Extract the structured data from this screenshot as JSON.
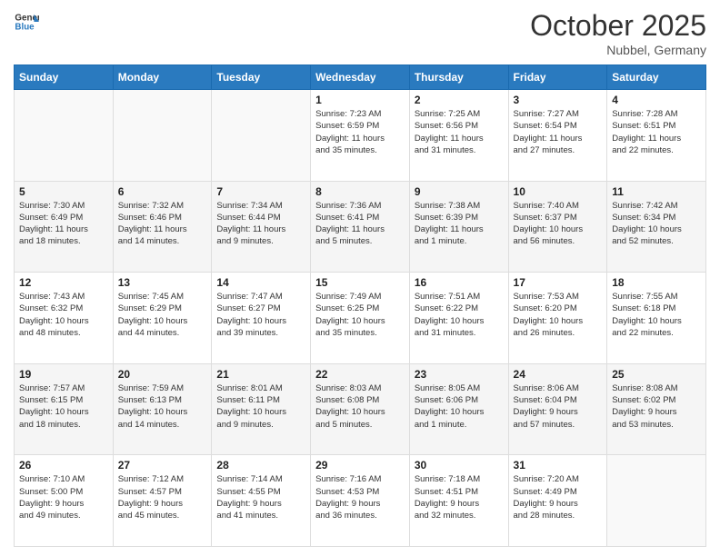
{
  "header": {
    "logo_general": "General",
    "logo_blue": "Blue",
    "month_title": "October 2025",
    "subtitle": "Nubbel, Germany"
  },
  "days_of_week": [
    "Sunday",
    "Monday",
    "Tuesday",
    "Wednesday",
    "Thursday",
    "Friday",
    "Saturday"
  ],
  "weeks": [
    [
      {
        "day": "",
        "info": ""
      },
      {
        "day": "",
        "info": ""
      },
      {
        "day": "",
        "info": ""
      },
      {
        "day": "1",
        "info": "Sunrise: 7:23 AM\nSunset: 6:59 PM\nDaylight: 11 hours\nand 35 minutes."
      },
      {
        "day": "2",
        "info": "Sunrise: 7:25 AM\nSunset: 6:56 PM\nDaylight: 11 hours\nand 31 minutes."
      },
      {
        "day": "3",
        "info": "Sunrise: 7:27 AM\nSunset: 6:54 PM\nDaylight: 11 hours\nand 27 minutes."
      },
      {
        "day": "4",
        "info": "Sunrise: 7:28 AM\nSunset: 6:51 PM\nDaylight: 11 hours\nand 22 minutes."
      }
    ],
    [
      {
        "day": "5",
        "info": "Sunrise: 7:30 AM\nSunset: 6:49 PM\nDaylight: 11 hours\nand 18 minutes."
      },
      {
        "day": "6",
        "info": "Sunrise: 7:32 AM\nSunset: 6:46 PM\nDaylight: 11 hours\nand 14 minutes."
      },
      {
        "day": "7",
        "info": "Sunrise: 7:34 AM\nSunset: 6:44 PM\nDaylight: 11 hours\nand 9 minutes."
      },
      {
        "day": "8",
        "info": "Sunrise: 7:36 AM\nSunset: 6:41 PM\nDaylight: 11 hours\nand 5 minutes."
      },
      {
        "day": "9",
        "info": "Sunrise: 7:38 AM\nSunset: 6:39 PM\nDaylight: 11 hours\nand 1 minute."
      },
      {
        "day": "10",
        "info": "Sunrise: 7:40 AM\nSunset: 6:37 PM\nDaylight: 10 hours\nand 56 minutes."
      },
      {
        "day": "11",
        "info": "Sunrise: 7:42 AM\nSunset: 6:34 PM\nDaylight: 10 hours\nand 52 minutes."
      }
    ],
    [
      {
        "day": "12",
        "info": "Sunrise: 7:43 AM\nSunset: 6:32 PM\nDaylight: 10 hours\nand 48 minutes."
      },
      {
        "day": "13",
        "info": "Sunrise: 7:45 AM\nSunset: 6:29 PM\nDaylight: 10 hours\nand 44 minutes."
      },
      {
        "day": "14",
        "info": "Sunrise: 7:47 AM\nSunset: 6:27 PM\nDaylight: 10 hours\nand 39 minutes."
      },
      {
        "day": "15",
        "info": "Sunrise: 7:49 AM\nSunset: 6:25 PM\nDaylight: 10 hours\nand 35 minutes."
      },
      {
        "day": "16",
        "info": "Sunrise: 7:51 AM\nSunset: 6:22 PM\nDaylight: 10 hours\nand 31 minutes."
      },
      {
        "day": "17",
        "info": "Sunrise: 7:53 AM\nSunset: 6:20 PM\nDaylight: 10 hours\nand 26 minutes."
      },
      {
        "day": "18",
        "info": "Sunrise: 7:55 AM\nSunset: 6:18 PM\nDaylight: 10 hours\nand 22 minutes."
      }
    ],
    [
      {
        "day": "19",
        "info": "Sunrise: 7:57 AM\nSunset: 6:15 PM\nDaylight: 10 hours\nand 18 minutes."
      },
      {
        "day": "20",
        "info": "Sunrise: 7:59 AM\nSunset: 6:13 PM\nDaylight: 10 hours\nand 14 minutes."
      },
      {
        "day": "21",
        "info": "Sunrise: 8:01 AM\nSunset: 6:11 PM\nDaylight: 10 hours\nand 9 minutes."
      },
      {
        "day": "22",
        "info": "Sunrise: 8:03 AM\nSunset: 6:08 PM\nDaylight: 10 hours\nand 5 minutes."
      },
      {
        "day": "23",
        "info": "Sunrise: 8:05 AM\nSunset: 6:06 PM\nDaylight: 10 hours\nand 1 minute."
      },
      {
        "day": "24",
        "info": "Sunrise: 8:06 AM\nSunset: 6:04 PM\nDaylight: 9 hours\nand 57 minutes."
      },
      {
        "day": "25",
        "info": "Sunrise: 8:08 AM\nSunset: 6:02 PM\nDaylight: 9 hours\nand 53 minutes."
      }
    ],
    [
      {
        "day": "26",
        "info": "Sunrise: 7:10 AM\nSunset: 5:00 PM\nDaylight: 9 hours\nand 49 minutes."
      },
      {
        "day": "27",
        "info": "Sunrise: 7:12 AM\nSunset: 4:57 PM\nDaylight: 9 hours\nand 45 minutes."
      },
      {
        "day": "28",
        "info": "Sunrise: 7:14 AM\nSunset: 4:55 PM\nDaylight: 9 hours\nand 41 minutes."
      },
      {
        "day": "29",
        "info": "Sunrise: 7:16 AM\nSunset: 4:53 PM\nDaylight: 9 hours\nand 36 minutes."
      },
      {
        "day": "30",
        "info": "Sunrise: 7:18 AM\nSunset: 4:51 PM\nDaylight: 9 hours\nand 32 minutes."
      },
      {
        "day": "31",
        "info": "Sunrise: 7:20 AM\nSunset: 4:49 PM\nDaylight: 9 hours\nand 28 minutes."
      },
      {
        "day": "",
        "info": ""
      }
    ]
  ]
}
